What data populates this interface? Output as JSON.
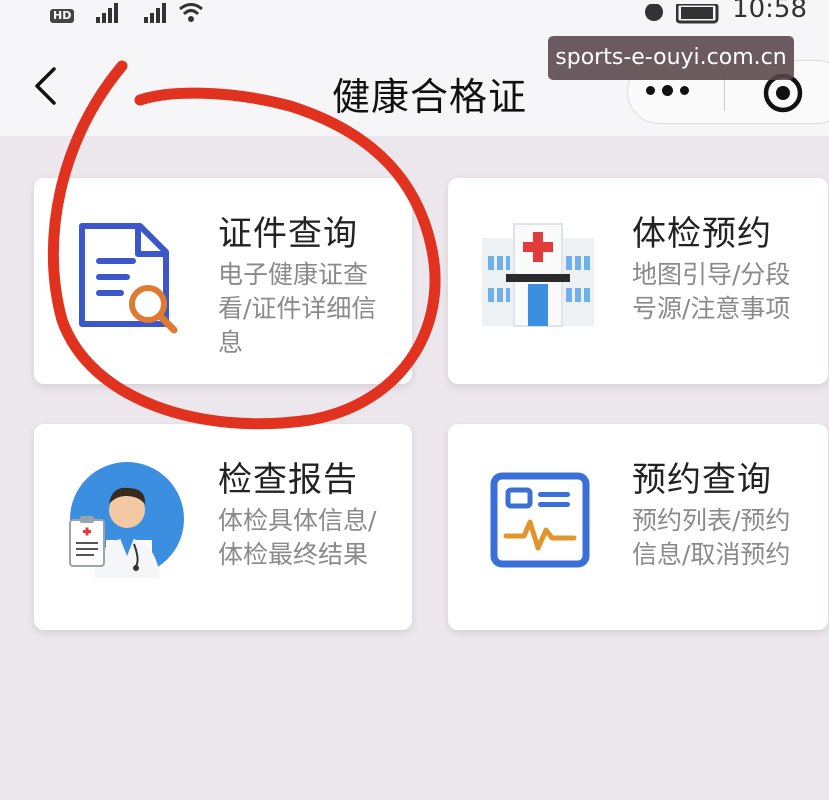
{
  "status_bar": {
    "hd_label": "HD",
    "sim1": "1",
    "sim2": "2",
    "time": "10:58"
  },
  "nav": {
    "title": "健康合格证",
    "back_icon": "chevron-left-icon",
    "more_icon": "more-dots-icon",
    "close_icon": "target-icon"
  },
  "watermark": "sports-e-ouyi.com.cn",
  "cards": [
    {
      "title": "证件查询",
      "desc": "电子健康证查看/证件详细信息",
      "icon": "document-search-icon"
    },
    {
      "title": "体检预约",
      "desc": "地图引导/分段号源/注意事项",
      "icon": "hospital-icon"
    },
    {
      "title": "检查报告",
      "desc": "体检具体信息/体检最终结果",
      "icon": "doctor-icon"
    },
    {
      "title": "预约查询",
      "desc": "预约列表/预约信息/取消预约",
      "icon": "id-card-pulse-icon"
    }
  ],
  "colors": {
    "highlight": "#e0321f",
    "doc_blue": "#3b57c9",
    "magnifier_orange": "#e07a33",
    "cross_red": "#e33b3b",
    "card_blue": "#3c8ee0"
  }
}
